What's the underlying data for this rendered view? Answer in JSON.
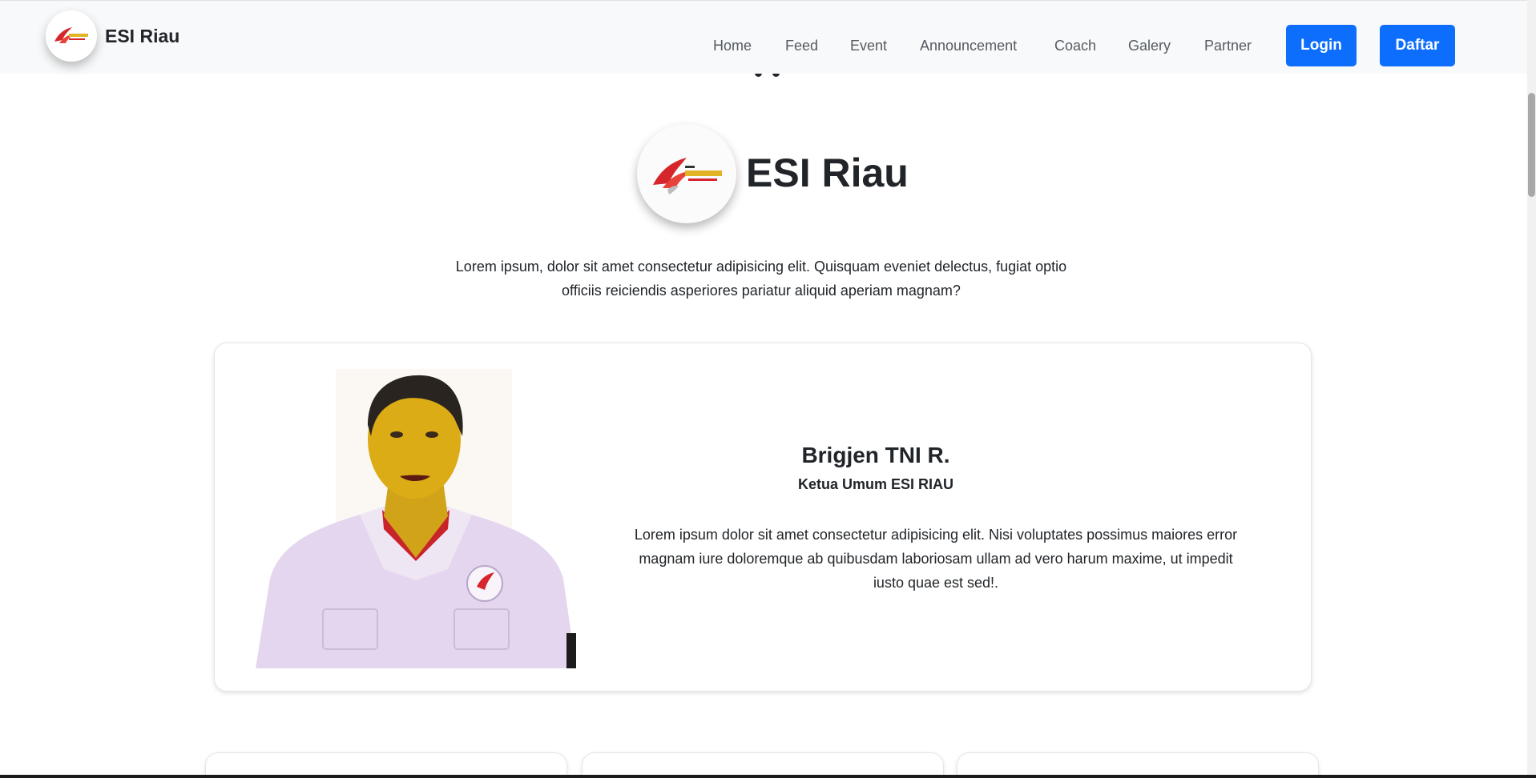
{
  "brand": {
    "name": "ESI Riau",
    "logo": "esports-indonesia-logo"
  },
  "nav": {
    "links": [
      "Home",
      "Feed",
      "Event",
      "Announcement",
      "Coach",
      "Galery",
      "Partner"
    ],
    "login_label": "Login",
    "register_label": "Daftar"
  },
  "hero": {
    "title": "ESI Riau",
    "description": "Lorem ipsum, dolor sit amet consectetur adipisicing elit. Quisquam eveniet delectus, fugiat optio officiis reiciendis asperiores pariatur aliquid aperiam magnam?"
  },
  "leader": {
    "name": "Brigjen TNI R.",
    "role": "Ketua Umum ESI RIAU",
    "description": "Lorem ipsum dolor sit amet consectetur adipisicing elit. Nisi voluptates possimus maiores error magnam iure doloremque ab quibusdam laboriosam ullam ad vero harum maxime, ut impedit iusto quae est sed!."
  },
  "colors": {
    "primary": "#0d6efd",
    "navbar_bg": "#f8f9fa",
    "text": "#212529"
  }
}
